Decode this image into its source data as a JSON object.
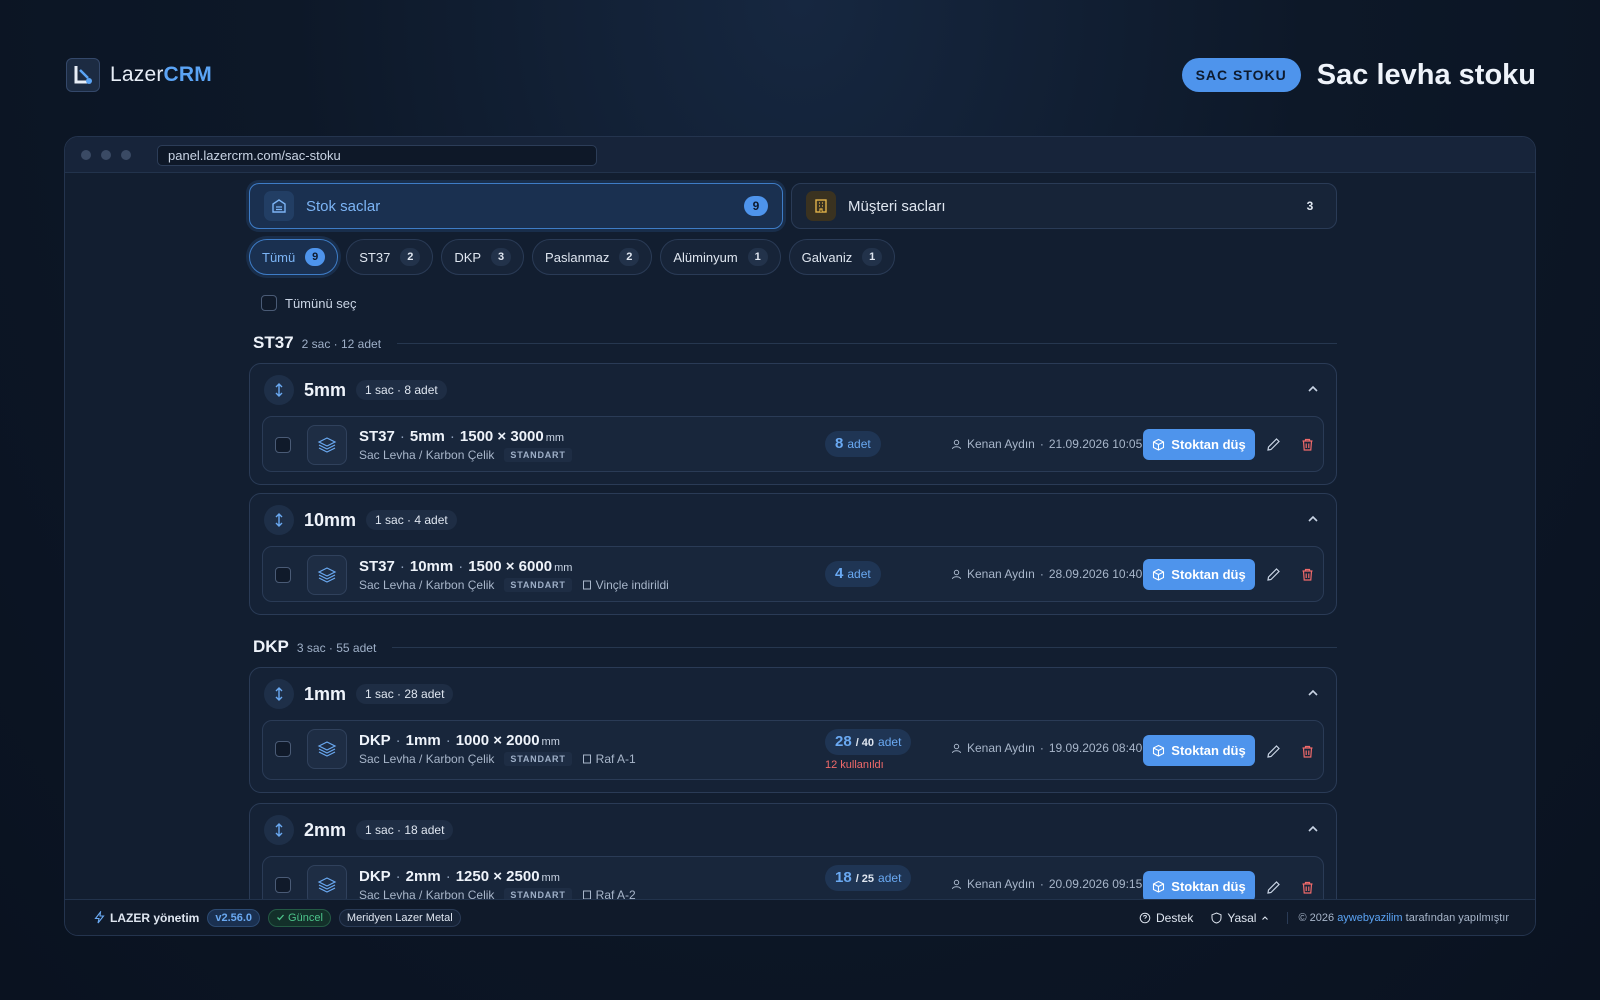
{
  "brand": {
    "name_a": "Lazer",
    "name_b": "CRM"
  },
  "header": {
    "badge": "SAC STOKU",
    "title": "Sac levha stoku"
  },
  "browser": {
    "url": "panel.lazercrm.com/sac-stoku"
  },
  "tabs": [
    {
      "label": "Stok saclar",
      "count": "9",
      "icon": "warehouse-icon"
    },
    {
      "label": "Müşteri sacları",
      "count": "3",
      "icon": "building-icon"
    }
  ],
  "filters": [
    {
      "label": "Tümü",
      "count": "9"
    },
    {
      "label": "ST37",
      "count": "2"
    },
    {
      "label": "DKP",
      "count": "3"
    },
    {
      "label": "Paslanmaz",
      "count": "2"
    },
    {
      "label": "Alüminyum",
      "count": "1"
    },
    {
      "label": "Galvaniz",
      "count": "1"
    }
  ],
  "select_all": "Tümünü seç",
  "groups": [
    {
      "name": "ST37",
      "meta": "2 sac · 12 adet",
      "subs": [
        {
          "title": "5mm",
          "meta": "1 sac · 8 adet",
          "item": {
            "material": "ST37",
            "thickness": "5mm",
            "dims": "1500 × 3000",
            "unit": "mm",
            "type": "Sac Levha / Karbon Çelik",
            "tag": "STANDART",
            "note": "",
            "qty": "8",
            "qty_total": "",
            "qty_unit": "adet",
            "used": "",
            "owner": "Kenan Aydın",
            "date": "21.09.2026 10:05"
          }
        },
        {
          "title": "10mm",
          "meta": "1 sac · 4 adet",
          "item": {
            "material": "ST37",
            "thickness": "10mm",
            "dims": "1500 × 6000",
            "unit": "mm",
            "type": "Sac Levha / Karbon Çelik",
            "tag": "STANDART",
            "note": "Vinçle indirildi",
            "qty": "4",
            "qty_total": "",
            "qty_unit": "adet",
            "used": "",
            "owner": "Kenan Aydın",
            "date": "28.09.2026 10:40"
          }
        }
      ]
    },
    {
      "name": "DKP",
      "meta": "3 sac · 55 adet",
      "subs": [
        {
          "title": "1mm",
          "meta": "1 sac · 28 adet",
          "item": {
            "material": "DKP",
            "thickness": "1mm",
            "dims": "1000 × 2000",
            "unit": "mm",
            "type": "Sac Levha / Karbon Çelik",
            "tag": "STANDART",
            "note": "Raf A-1",
            "qty": "28",
            "qty_total": "/ 40",
            "qty_unit": "adet",
            "used": "12 kullanıldı",
            "owner": "Kenan Aydın",
            "date": "19.09.2026 08:40"
          }
        },
        {
          "title": "2mm",
          "meta": "1 sac · 18 adet",
          "item": {
            "material": "DKP",
            "thickness": "2mm",
            "dims": "1250 × 2500",
            "unit": "mm",
            "type": "Sac Levha / Karbon Çelik",
            "tag": "STANDART",
            "note": "Raf A-2",
            "qty": "18",
            "qty_total": "/ 25",
            "qty_unit": "adet",
            "used": "",
            "owner": "Kenan Aydın",
            "date": "20.09.2026 09:15"
          }
        }
      ]
    }
  ],
  "actions": {
    "stock_out": "Stoktan düş"
  },
  "footer": {
    "brand": "LAZER yönetim",
    "version": "v2.56.0",
    "status": "Güncel",
    "org": "Meridyen Lazer Metal",
    "support": "Destek",
    "legal": "Yasal",
    "copy_a": "© 2026",
    "copy_link": "aywebyazilim",
    "copy_b": "tarafından yapılmıştır"
  },
  "colors": {
    "accent": "#4e94ec",
    "danger": "#f06a6a",
    "success": "#4cc38a",
    "bg": "#0d1828"
  }
}
